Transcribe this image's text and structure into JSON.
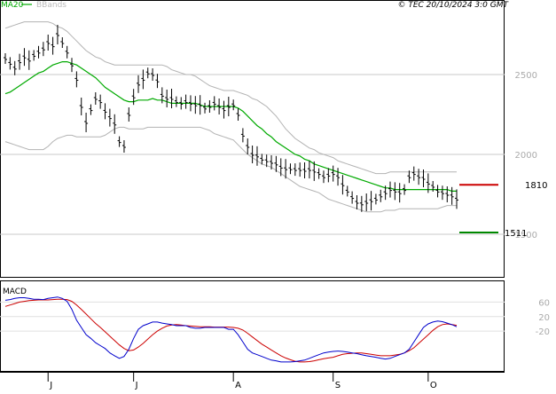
{
  "header": {
    "ma_label": "MA20",
    "bb_label": "BBands",
    "source_label": "© TEC 20/10/2024 3:0 GMT"
  },
  "colors": {
    "ma": "#00aa00",
    "bbands": "#b3b3b3",
    "price": "#000000",
    "grid": "#c8c8c8",
    "resistance": "#cc0000",
    "support": "#008800",
    "macd": "#0000cc",
    "signal": "#cc0000",
    "axis_text": "#aaaaaa"
  },
  "levels": {
    "resistance": {
      "label": "1810",
      "value": 1810
    },
    "support": {
      "label": "1511",
      "value": 1511
    }
  },
  "chart_data": [
    {
      "type": "ohlc",
      "title": "",
      "y_ticks": [
        {
          "label": "2500",
          "value": 2500
        },
        {
          "label": "2000",
          "value": 2000
        },
        {
          "label": "1500",
          "value": 1500
        }
      ],
      "ylim": [
        1300,
        2900
      ],
      "x_months": [
        "J",
        "J",
        "A",
        "S",
        "O"
      ],
      "grid": true,
      "series": [
        {
          "name": "price",
          "points": [
            [
              0,
              2600
            ],
            [
              1,
              2570
            ],
            [
              2,
              2540
            ],
            [
              3,
              2580
            ],
            [
              4,
              2610
            ],
            [
              5,
              2590
            ],
            [
              6,
              2620
            ],
            [
              7,
              2640
            ],
            [
              8,
              2660
            ],
            [
              9,
              2700
            ],
            [
              10,
              2680
            ],
            [
              11,
              2750
            ],
            [
              12,
              2700
            ],
            [
              13,
              2640
            ],
            [
              14,
              2560
            ],
            [
              15,
              2470
            ],
            [
              16,
              2300
            ],
            [
              17,
              2200
            ],
            [
              18,
              2280
            ],
            [
              19,
              2350
            ],
            [
              20,
              2330
            ],
            [
              21,
              2270
            ],
            [
              22,
              2230
            ],
            [
              23,
              2190
            ],
            [
              24,
              2080
            ],
            [
              25,
              2050
            ],
            [
              26,
              2250
            ],
            [
              27,
              2360
            ],
            [
              28,
              2440
            ],
            [
              29,
              2470
            ],
            [
              30,
              2510
            ],
            [
              31,
              2500
            ],
            [
              32,
              2460
            ],
            [
              33,
              2370
            ],
            [
              34,
              2350
            ],
            [
              35,
              2350
            ],
            [
              36,
              2330
            ],
            [
              37,
              2320
            ],
            [
              38,
              2330
            ],
            [
              39,
              2320
            ],
            [
              40,
              2310
            ],
            [
              41,
              2310
            ],
            [
              42,
              2290
            ],
            [
              43,
              2300
            ],
            [
              44,
              2320
            ],
            [
              45,
              2300
            ],
            [
              46,
              2280
            ],
            [
              47,
              2300
            ],
            [
              48,
              2310
            ],
            [
              49,
              2250
            ],
            [
              50,
              2120
            ],
            [
              51,
              2050
            ],
            [
              52,
              2000
            ],
            [
              53,
              1990
            ],
            [
              54,
              1970
            ],
            [
              55,
              1960
            ],
            [
              56,
              1950
            ],
            [
              57,
              1940
            ],
            [
              58,
              1920
            ],
            [
              59,
              1910
            ],
            [
              60,
              1910
            ],
            [
              61,
              1905
            ],
            [
              62,
              1905
            ],
            [
              63,
              1900
            ],
            [
              64,
              1905
            ],
            [
              65,
              1895
            ],
            [
              66,
              1880
            ],
            [
              67,
              1860
            ],
            [
              68,
              1870
            ],
            [
              69,
              1880
            ],
            [
              70,
              1860
            ],
            [
              71,
              1810
            ],
            [
              72,
              1770
            ],
            [
              73,
              1730
            ],
            [
              74,
              1700
            ],
            [
              75,
              1690
            ],
            [
              76,
              1700
            ],
            [
              77,
              1710
            ],
            [
              78,
              1720
            ],
            [
              79,
              1740
            ],
            [
              80,
              1760
            ],
            [
              81,
              1780
            ],
            [
              82,
              1770
            ],
            [
              83,
              1760
            ],
            [
              84,
              1780
            ],
            [
              85,
              1860
            ],
            [
              86,
              1880
            ],
            [
              87,
              1860
            ],
            [
              88,
              1850
            ],
            [
              89,
              1820
            ],
            [
              90,
              1800
            ],
            [
              91,
              1770
            ],
            [
              92,
              1760
            ],
            [
              93,
              1750
            ],
            [
              94,
              1740
            ],
            [
              95,
              1720
            ]
          ]
        },
        {
          "name": "MA20",
          "values": [
            2380,
            2390,
            2410,
            2430,
            2450,
            2470,
            2490,
            2510,
            2520,
            2540,
            2560,
            2570,
            2580,
            2580,
            2570,
            2560,
            2540,
            2520,
            2500,
            2480,
            2450,
            2420,
            2400,
            2380,
            2360,
            2340,
            2330,
            2330,
            2340,
            2340,
            2340,
            2350,
            2340,
            2340,
            2330,
            2320,
            2320,
            2320,
            2320,
            2320,
            2320,
            2310,
            2300,
            2300,
            2300,
            2300,
            2300,
            2300,
            2300,
            2290,
            2270,
            2240,
            2210,
            2180,
            2160,
            2130,
            2110,
            2080,
            2060,
            2040,
            2020,
            2000,
            1990,
            1970,
            1960,
            1940,
            1930,
            1920,
            1910,
            1900,
            1890,
            1880,
            1870,
            1860,
            1850,
            1840,
            1830,
            1820,
            1810,
            1800,
            1790,
            1790,
            1780,
            1780,
            1780,
            1780,
            1780,
            1780,
            1780,
            1780,
            1780,
            1780,
            1780,
            1780,
            1770,
            1770
          ]
        },
        {
          "name": "BBands upper",
          "values": [
            2790,
            2800,
            2810,
            2820,
            2830,
            2830,
            2830,
            2830,
            2830,
            2830,
            2820,
            2800,
            2790,
            2770,
            2740,
            2710,
            2680,
            2650,
            2630,
            2610,
            2600,
            2580,
            2570,
            2560,
            2560,
            2560,
            2560,
            2560,
            2560,
            2560,
            2560,
            2560,
            2560,
            2560,
            2550,
            2530,
            2520,
            2510,
            2500,
            2500,
            2490,
            2470,
            2450,
            2430,
            2420,
            2410,
            2400,
            2400,
            2400,
            2390,
            2380,
            2370,
            2350,
            2340,
            2320,
            2300,
            2270,
            2240,
            2200,
            2160,
            2130,
            2100,
            2080,
            2060,
            2040,
            2030,
            2010,
            2000,
            1990,
            1980,
            1960,
            1950,
            1940,
            1930,
            1920,
            1910,
            1900,
            1890,
            1880,
            1880,
            1880,
            1890,
            1890,
            1890,
            1890,
            1890,
            1890,
            1890,
            1890,
            1890,
            1890,
            1890,
            1890,
            1890,
            1890,
            1890
          ]
        },
        {
          "name": "BBands lower",
          "values": [
            2080,
            2070,
            2060,
            2050,
            2040,
            2030,
            2030,
            2030,
            2030,
            2050,
            2080,
            2100,
            2110,
            2120,
            2120,
            2110,
            2110,
            2110,
            2110,
            2110,
            2110,
            2120,
            2140,
            2160,
            2170,
            2170,
            2160,
            2160,
            2160,
            2160,
            2170,
            2170,
            2170,
            2170,
            2170,
            2170,
            2170,
            2170,
            2170,
            2170,
            2170,
            2170,
            2160,
            2150,
            2130,
            2120,
            2110,
            2100,
            2090,
            2060,
            2030,
            2000,
            1980,
            1960,
            1940,
            1930,
            1920,
            1900,
            1880,
            1860,
            1840,
            1820,
            1800,
            1790,
            1780,
            1770,
            1760,
            1740,
            1720,
            1710,
            1700,
            1690,
            1680,
            1670,
            1660,
            1650,
            1640,
            1640,
            1640,
            1640,
            1650,
            1650,
            1650,
            1660,
            1660,
            1660,
            1660,
            1660,
            1660,
            1660,
            1660,
            1660,
            1670,
            1680,
            1680,
            1680
          ]
        }
      ]
    },
    {
      "type": "line",
      "title": "MACD",
      "y_ticks": [
        {
          "label": "60",
          "value": 60
        },
        {
          "label": "20",
          "value": 20
        },
        {
          "label": "-20",
          "value": -20
        }
      ],
      "ylim": [
        -120,
        110
      ],
      "series": [
        {
          "name": "MACD",
          "values": [
            65,
            67,
            70,
            72,
            72,
            70,
            68,
            68,
            67,
            70,
            72,
            74,
            70,
            62,
            40,
            10,
            -10,
            -30,
            -40,
            -52,
            -60,
            -68,
            -80,
            -88,
            -95,
            -90,
            -70,
            -40,
            -15,
            -5,
            0,
            5,
            5,
            2,
            0,
            -2,
            -5,
            -5,
            -5,
            -10,
            -12,
            -12,
            -10,
            -10,
            -10,
            -10,
            -10,
            -15,
            -15,
            -30,
            -50,
            -70,
            -80,
            -85,
            -90,
            -95,
            -100,
            -102,
            -105,
            -105,
            -105,
            -104,
            -102,
            -100,
            -95,
            -90,
            -85,
            -80,
            -78,
            -76,
            -75,
            -76,
            -78,
            -80,
            -82,
            -85,
            -88,
            -90,
            -92,
            -95,
            -97,
            -95,
            -90,
            -85,
            -80,
            -70,
            -50,
            -30,
            -10,
            0,
            5,
            8,
            6,
            2,
            -2,
            -8
          ]
        },
        {
          "name": "Signal",
          "values": [
            48,
            52,
            56,
            60,
            62,
            64,
            65,
            66,
            66,
            66,
            67,
            68,
            68,
            67,
            62,
            52,
            40,
            27,
            14,
            1,
            -10,
            -22,
            -34,
            -46,
            -58,
            -68,
            -74,
            -72,
            -64,
            -54,
            -42,
            -30,
            -20,
            -12,
            -6,
            -3,
            -2,
            -3,
            -5,
            -6,
            -7,
            -8,
            -8,
            -8,
            -9,
            -9,
            -9,
            -9,
            -10,
            -12,
            -17,
            -26,
            -36,
            -46,
            -56,
            -64,
            -72,
            -80,
            -88,
            -94,
            -99,
            -103,
            -105,
            -105,
            -104,
            -102,
            -99,
            -96,
            -94,
            -92,
            -88,
            -84,
            -82,
            -81,
            -80,
            -80,
            -82,
            -84,
            -86,
            -88,
            -88,
            -88,
            -86,
            -84,
            -80,
            -74,
            -66,
            -54,
            -42,
            -30,
            -18,
            -8,
            -2,
            0,
            -2,
            -4
          ]
        }
      ]
    }
  ]
}
